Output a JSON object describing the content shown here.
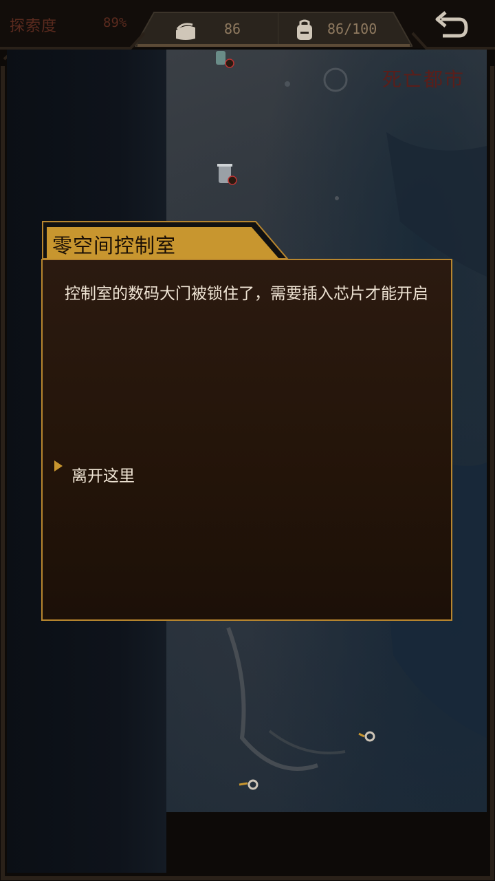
{
  "topbar": {
    "explore_label": "探索度",
    "explore_value": "89%",
    "food_value": "86",
    "bag_value": "86/100"
  },
  "map": {
    "city_name": "死亡都市"
  },
  "dialog": {
    "title": "零空间控制室",
    "message": "控制室的数码大门被锁住了，需要插入芯片才能开启",
    "options": [
      "离开这里"
    ]
  },
  "colors": {
    "accent_gold": "#c8962f",
    "frame_dark": "#2a2119",
    "text_light": "#efe4d4",
    "muted_red": "#5a2a1e"
  }
}
